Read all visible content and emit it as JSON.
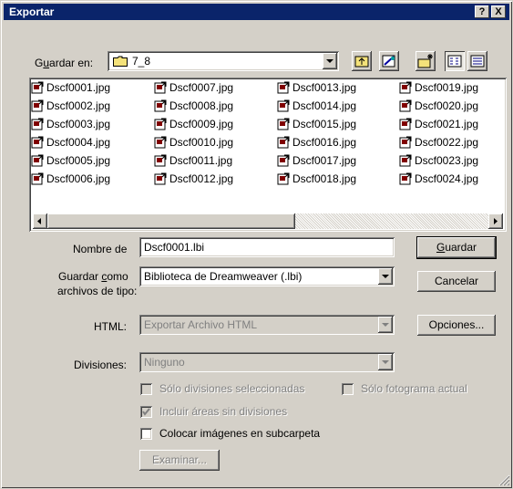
{
  "window": {
    "title": "Exportar",
    "help_btn": "?",
    "close_btn": "X"
  },
  "save_in": {
    "label_prefix": "G",
    "label_underlined": "u",
    "label_suffix": "ardar en:",
    "folder": "7_8"
  },
  "files": [
    "Dscf0001.jpg",
    "Dscf0002.jpg",
    "Dscf0003.jpg",
    "Dscf0004.jpg",
    "Dscf0005.jpg",
    "Dscf0006.jpg",
    "Dscf0007.jpg",
    "Dscf0008.jpg",
    "Dscf0009.jpg",
    "Dscf0010.jpg",
    "Dscf0011.jpg",
    "Dscf0012.jpg",
    "Dscf0013.jpg",
    "Dscf0014.jpg",
    "Dscf0015.jpg",
    "Dscf0016.jpg",
    "Dscf0017.jpg",
    "Dscf0018.jpg",
    "Dscf0019.jpg",
    "Dscf0020.jpg",
    "Dscf0021.jpg",
    "Dscf0022.jpg",
    "Dscf0023.jpg",
    "Dscf0024.jpg"
  ],
  "filename": {
    "label": "Nombre de",
    "value": "Dscf0001.lbi"
  },
  "filetype": {
    "label_line1_a": "Guardar ",
    "label_line1_u": "c",
    "label_line1_b": "omo",
    "label_line2": "archivos de tipo:",
    "value": "Biblioteca de Dreamweaver (.lbi)"
  },
  "html": {
    "label": "HTML:",
    "value": "Exportar Archivo HTML"
  },
  "divisions": {
    "label": "Divisiones:",
    "value": "Ninguno"
  },
  "buttons": {
    "save_u": "G",
    "save_rest": "uardar",
    "cancel": "Cancelar",
    "options": "Opciones...",
    "browse": "Examinar..."
  },
  "checkboxes": {
    "selected_slices": {
      "label": "Sólo divisiones seleccionadas",
      "checked": false,
      "enabled": false
    },
    "current_frame": {
      "label": "Sólo fotograma actual",
      "checked": false,
      "enabled": false
    },
    "include_areas": {
      "label": "Incluir áreas sin divisiones",
      "checked": true,
      "enabled": false
    },
    "subfolder": {
      "label": "Colocar imágenes en subcarpeta",
      "checked": false,
      "enabled": true
    }
  },
  "icons": [
    "up-folder-icon",
    "new-folder-icon",
    "desktop-icon",
    "list-view-icon",
    "details-view-icon",
    "folder-icon",
    "jpg-file-icon",
    "help-icon",
    "close-icon",
    "scroll-left-icon",
    "scroll-right-icon",
    "dropdown-arrow-icon"
  ]
}
